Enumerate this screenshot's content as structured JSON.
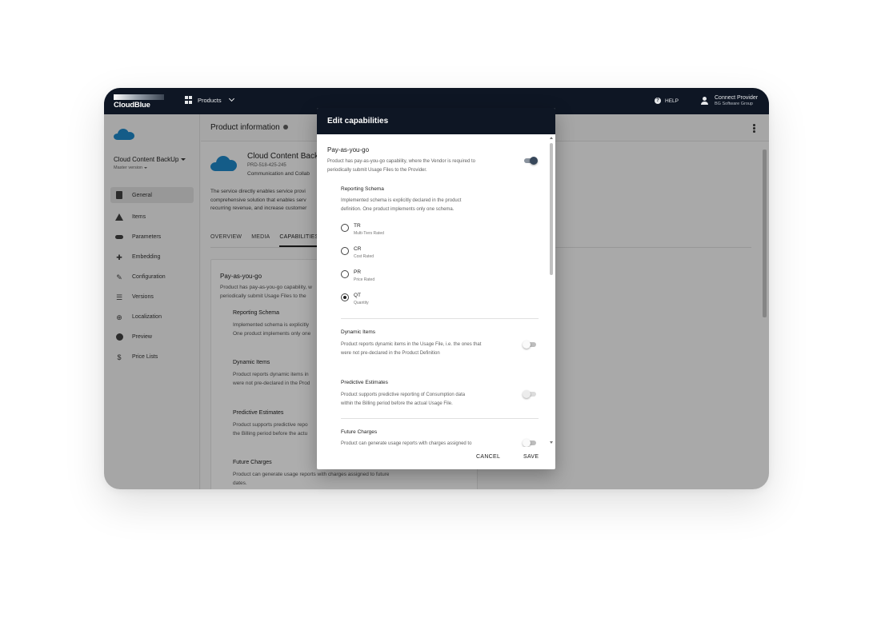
{
  "topbar": {
    "logo_text": "CloudBlue",
    "products_label": "Products",
    "help_label": "HELP",
    "account_name": "Connect Provider",
    "account_org": "BG Software Group"
  },
  "sidebar": {
    "product_title": "Cloud Content BackUp",
    "version_label": "Master version",
    "items": [
      {
        "label": "General",
        "icon": "clipboard-icon"
      },
      {
        "label": "Items",
        "icon": "shapes-icon"
      },
      {
        "label": "Parameters",
        "icon": "toggle-pill-icon"
      },
      {
        "label": "Embedding",
        "icon": "puzzle-icon"
      },
      {
        "label": "Configuration",
        "icon": "wrench-icon"
      },
      {
        "label": "Versions",
        "icon": "list-icon"
      },
      {
        "label": "Localization",
        "icon": "globe-icon"
      },
      {
        "label": "Preview",
        "icon": "play-circle-icon"
      },
      {
        "label": "Price Lists",
        "icon": "dollar-icon"
      }
    ]
  },
  "main": {
    "page_title": "Product information",
    "product_name": "Cloud Content BackU",
    "product_id": "PRD-518-425-245",
    "product_category": "Communication and Collab",
    "description_lines": [
      "The service directly enables service provi",
      "comprehensive solution that enables serv",
      "recurring revenue, and increase customer"
    ],
    "tabs": [
      "OVERVIEW",
      "MEDIA",
      "CAPABILITIES"
    ],
    "card": {
      "title": "Pay-as-you-go",
      "desc_lines": [
        "Product has pay-as-you-go capability, w",
        "periodically submit Usage Files to the"
      ],
      "reporting_schema": "Reporting Schema",
      "reporting_desc": [
        "Implemented schema is explicitly",
        "One product implements only one"
      ],
      "dynamic_items": "Dynamic Items",
      "dynamic_desc": [
        "Product reports dynamic items in",
        "were not pre-declared in the Prod"
      ],
      "predictive": "Predictive Estimates",
      "predictive_desc": [
        "Product supports predictive repo",
        "the Billing period before the actu"
      ],
      "future": "Future Charges",
      "future_desc": [
        "Product can generate usage reports with charges assigned to future",
        "dates."
      ]
    }
  },
  "modal": {
    "title": "Edit capabilities",
    "payg": {
      "title": "Pay-as-you-go",
      "desc_1": "Product has pay-as-you-go capability, where the Vendor is required to",
      "desc_2": "periodically submit Usage Files to the Provider.",
      "enabled": true
    },
    "reporting": {
      "title": "Reporting Schema",
      "desc_1": "Implemented schema is explicitly declared in the product",
      "desc_2": "definition. One product implements only one schema.",
      "options": [
        {
          "code": "TR",
          "label": "Multi-Tiers Rated",
          "checked": false
        },
        {
          "code": "CR",
          "label": "Cost Rated",
          "checked": false
        },
        {
          "code": "PR",
          "label": "Price Rated",
          "checked": false
        },
        {
          "code": "QT",
          "label": "Quantity",
          "checked": true
        }
      ]
    },
    "dynamic": {
      "title": "Dynamic Items",
      "desc_1": "Product reports dynamic items in the Usage File, i.e. the ones that",
      "desc_2": "were not pre-declared in the Product Definition",
      "enabled": false
    },
    "predictive": {
      "title": "Predictive Estimates",
      "desc_1": "Product supports predictive reporting of Consumption data",
      "desc_2": "within the Billing period before the actual Usage File.",
      "enabled": false
    },
    "future": {
      "title": "Future Charges",
      "desc_1": "Product can generate usage reports with charges assigned to",
      "enabled": false
    },
    "cancel_label": "CANCEL",
    "save_label": "SAVE"
  }
}
